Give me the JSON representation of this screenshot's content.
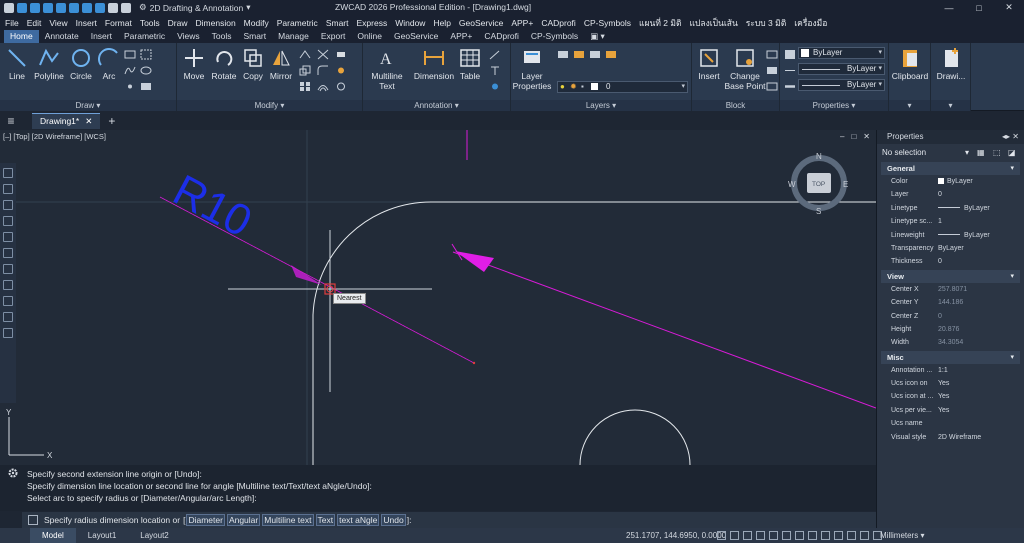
{
  "titlebar": {
    "workspace": "2D Drafting & Annotation",
    "title": "ZWCAD 2026 Professional Edition - [Drawing1.dwg]",
    "minimize": "—",
    "maximize": "□",
    "close": "✕"
  },
  "menubar": [
    "File",
    "Edit",
    "View",
    "Insert",
    "Format",
    "Tools",
    "Draw",
    "Dimension",
    "Modify",
    "Parametric",
    "Smart",
    "Express",
    "Window",
    "Help",
    "GeoService",
    "APP+",
    "CADprofi",
    "CP-Symbols",
    "แผนที่ 2 มิติ",
    "แปลงเป็นเส้น",
    "ระบบ 3 มิติ",
    "เครื่องมือ"
  ],
  "ribbon_tabs": [
    "Home",
    "Annotate",
    "Insert",
    "Parametric",
    "Views",
    "Tools",
    "Smart",
    "Manage",
    "Export",
    "Online",
    "GeoService",
    "APP+",
    "CADprofi",
    "CP-Symbols"
  ],
  "ribbon": {
    "draw": {
      "title": "Draw",
      "line": "Line",
      "polyline": "Polyline",
      "circle": "Circle",
      "arc": "Arc"
    },
    "modify": {
      "title": "Modify",
      "move": "Move",
      "rotate": "Rotate",
      "copy": "Copy",
      "mirror": "Mirror"
    },
    "annotation": {
      "title": "Annotation",
      "mtext1": "Multiline",
      "mtext2": "Text",
      "dimension": "Dimension",
      "table": "Table"
    },
    "layers": {
      "title": "Layers",
      "props1": "Layer",
      "props2": "Properties",
      "current_layer": "0"
    },
    "block": {
      "title": "Block",
      "insert": "Insert",
      "change1": "Change",
      "change2": "Base Point"
    },
    "properties": {
      "title": "Properties",
      "color": "ByLayer",
      "linetype": "ByLayer",
      "lineweight": "ByLayer"
    },
    "clipboard": {
      "title": "Clipboard"
    },
    "drawing": {
      "title": "Drawi..."
    }
  },
  "filetabs": {
    "active": "Drawing1*",
    "close": "✕",
    "new": "+"
  },
  "viewport": {
    "label": "[–] [Top] [2D Wireframe] [WCS]",
    "dimension_text": "R10",
    "snap_tooltip": "Nearest",
    "viewcube": {
      "n": "N",
      "s": "S",
      "e": "E",
      "w": "W",
      "top": "TOP"
    },
    "ucs_x": "X",
    "ucs_y": "Y",
    "win_min": "–",
    "win_max": "□",
    "win_close": "✕"
  },
  "command": {
    "history": [
      "Specify second extension line origin or [Undo]:",
      "Specify dimension line location or second line for angle [Multiline text/Text/text aNgle/Undo]:",
      "Select arc to specify radius or [Diameter/Angular/arc Length]:"
    ],
    "prompt": "Specify radius dimension location or",
    "options": [
      "Diameter",
      "Angular",
      "Multiline text",
      "Text",
      "text aNgle",
      "Undo"
    ],
    "bracket_open": "[",
    "bracket_close": "]:"
  },
  "statusbar": {
    "layouts": [
      "Model",
      "Layout1",
      "Layout2"
    ],
    "coords": "251.1707, 144.6950, 0.0000",
    "units": "Millimeters"
  },
  "properties_panel": {
    "title": "Properties",
    "selection": "No selection",
    "sections": [
      {
        "name": "General",
        "rows": [
          {
            "k": "Color",
            "v": "ByLayer",
            "kind": "swatch"
          },
          {
            "k": "Layer",
            "v": "0"
          },
          {
            "k": "Linetype",
            "v": "ByLayer",
            "kind": "line"
          },
          {
            "k": "Linetype sc...",
            "v": "1"
          },
          {
            "k": "Lineweight",
            "v": "ByLayer",
            "kind": "line"
          },
          {
            "k": "Transparency",
            "v": "ByLayer"
          },
          {
            "k": "Thickness",
            "v": "0"
          }
        ]
      },
      {
        "name": "View",
        "rows": [
          {
            "k": "Center X",
            "v": "257.8071",
            "kind": "dim"
          },
          {
            "k": "Center Y",
            "v": "144.186",
            "kind": "dim"
          },
          {
            "k": "Center Z",
            "v": "0",
            "kind": "dim"
          },
          {
            "k": "Height",
            "v": "20.876",
            "kind": "dim"
          },
          {
            "k": "Width",
            "v": "34.3054",
            "kind": "dim"
          }
        ]
      },
      {
        "name": "Misc",
        "rows": [
          {
            "k": "Annotation ...",
            "v": "1:1"
          },
          {
            "k": "Ucs icon on",
            "v": "Yes"
          },
          {
            "k": "Ucs icon at ...",
            "v": "Yes"
          },
          {
            "k": "Ucs per vie...",
            "v": "Yes"
          },
          {
            "k": "Ucs name",
            "v": ""
          },
          {
            "k": "Visual style",
            "v": "2D Wireframe"
          }
        ]
      }
    ]
  },
  "colors": {
    "accent": "#3e6aa0",
    "magenta": "#d81bd8",
    "dimblue": "#1c2ee8"
  }
}
